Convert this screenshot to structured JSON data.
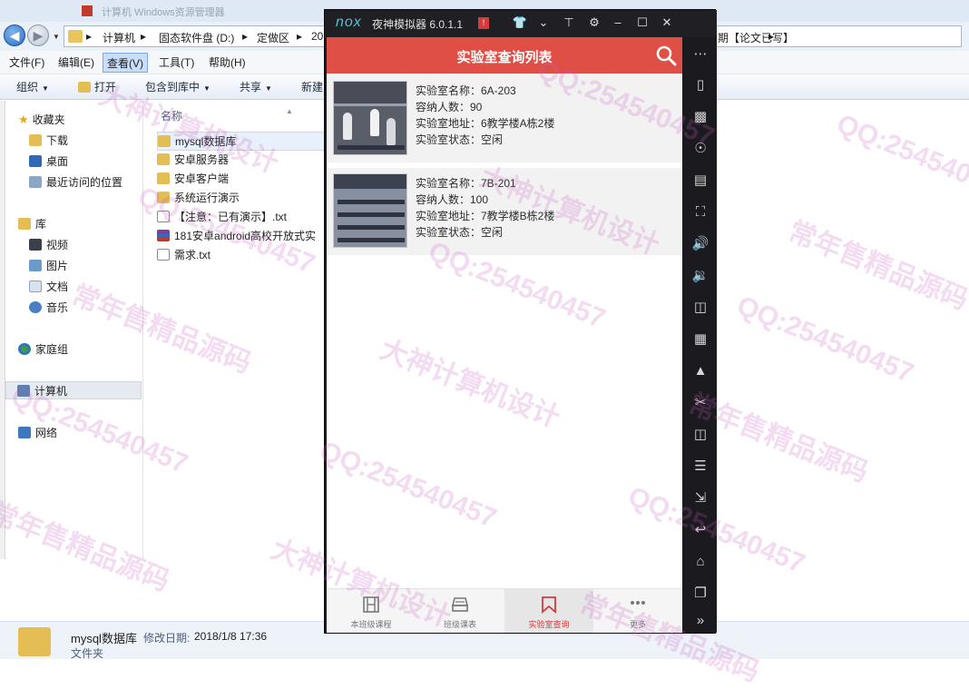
{
  "explorer": {
    "title_tab_text": "计算机 Windows资源管理器",
    "address": {
      "crumbs": [
        "计算机",
        "固态软件盘 (D:)",
        "定做区",
        "20"
      ],
      "tail": "期【论文已写】"
    },
    "menu": [
      "文件(F)",
      "编辑(E)",
      "查看(V)",
      "工具(T)",
      "帮助(H)"
    ],
    "toolbar": {
      "organize": "组织",
      "open": "打开",
      "include": "包含到库中",
      "share": "共享",
      "new": "新建"
    },
    "nav": {
      "favorites": "收藏夹",
      "downloads": "下载",
      "desktop": "桌面",
      "recent": "最近访问的位置",
      "libraries": "库",
      "videos": "视频",
      "pictures": "图片",
      "documents": "文档",
      "music": "音乐",
      "homegroup": "家庭组",
      "computer": "计算机",
      "network": "网络"
    },
    "files": {
      "column_name": "名称",
      "items": [
        {
          "name": "mysql数据库",
          "type": "folder"
        },
        {
          "name": "安卓服务器",
          "type": "folder"
        },
        {
          "name": "安卓客户端",
          "type": "folder"
        },
        {
          "name": "系统运行演示",
          "type": "folder"
        },
        {
          "name": "【注意：已有演示】.txt",
          "type": "txt"
        },
        {
          "name": "181安卓android高校开放式实",
          "type": "rar"
        },
        {
          "name": "需求.txt",
          "type": "txt"
        }
      ]
    },
    "status": {
      "name": "mysql数据库",
      "meta_label": "修改日期:",
      "date": "2018/1/8 17:36",
      "type": "文件夹"
    }
  },
  "nox": {
    "logo": "nox",
    "name": "夜神模拟器",
    "version": "6.0.1.1",
    "badge": "!",
    "app": {
      "title": "实验室查询列表",
      "labs": [
        {
          "name": "实验室名称：6A-203",
          "capacity": "容纳人数：90",
          "address": "实验室地址：6教学楼A栋2楼",
          "status": "实验室状态：空闲"
        },
        {
          "name": "实验室名称：7B-201",
          "capacity": "容纳人数：100",
          "address": "实验室地址：7教学楼B栋2楼",
          "status": "实验室状态：空闲"
        }
      ],
      "bottom_nav": [
        "本班级课程",
        "班级课表",
        "实验室查询",
        "更多"
      ]
    }
  },
  "watermarks": {
    "qq": "QQ:254540457",
    "design": "大神计算机设计",
    "source": "常年售精品源码"
  },
  "colors": {
    "app_accent": "#e04f45",
    "explorer_bg": "#eaf1f9",
    "nox_chrome": "#1b1b1f"
  }
}
